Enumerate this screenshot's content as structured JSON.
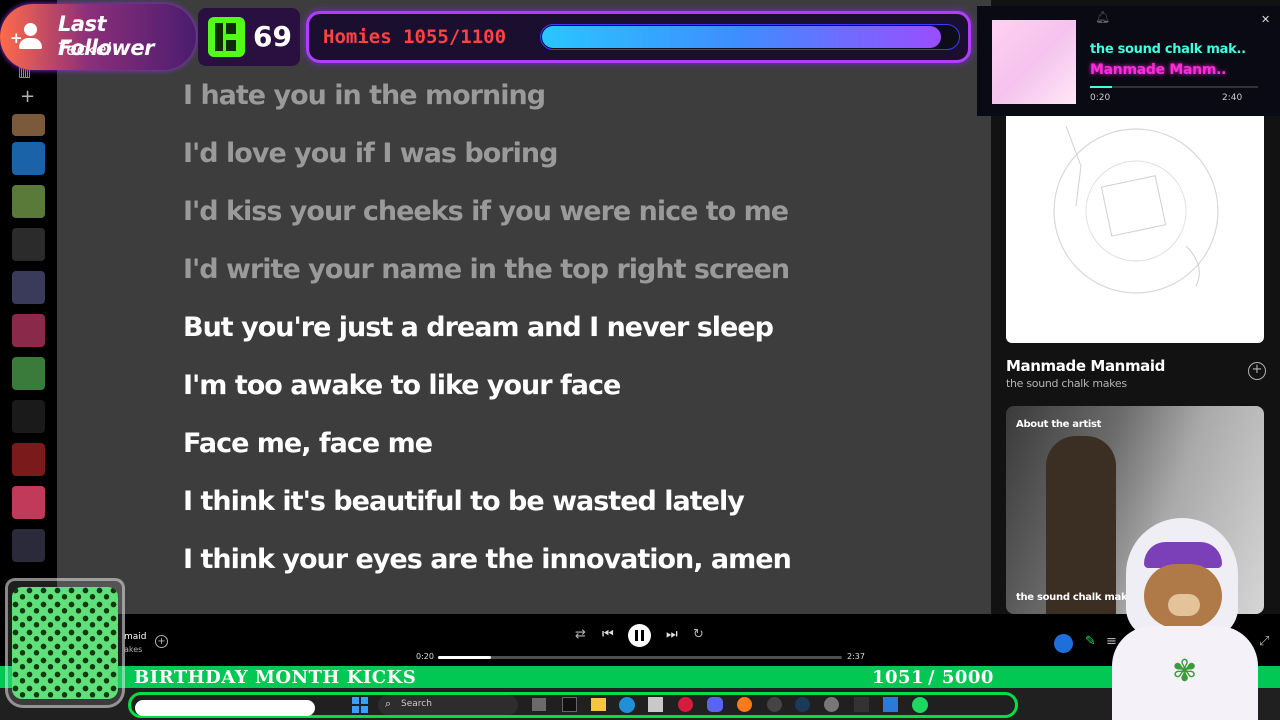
{
  "overlay": {
    "follower_title": "Last Follower",
    "follower_name": "Teckel",
    "kick_count": "69",
    "homies_label": "Homies 1055/1100",
    "homies_progress": 0.959
  },
  "now_playing_widget": {
    "title": "the sound chalk mak..",
    "artist": "Manmade Manm..",
    "elapsed": "0:20",
    "duration": "2:40"
  },
  "lyrics": [
    {
      "text": "I hate you in the morning",
      "state": "past"
    },
    {
      "text": "I'd love you if I was boring",
      "state": "past"
    },
    {
      "text": "I'd kiss your cheeks if you were nice to me",
      "state": "past"
    },
    {
      "text": "I'd write your name in the top right screen",
      "state": "past"
    },
    {
      "text": "But you're just a dream and I never sleep",
      "state": "current"
    },
    {
      "text": "I'm too awake to like your face",
      "state": "next"
    },
    {
      "text": "Face me, face me",
      "state": "next"
    },
    {
      "text": "I think it's beautiful to be wasted lately",
      "state": "next"
    },
    {
      "text": "I think your eyes are the innovation, amen",
      "state": "next"
    }
  ],
  "right_panel": {
    "track_title": "Manmade Manmaid",
    "track_artist": "the sound chalk makes",
    "about_label": "About the artist",
    "artist_name": "the sound chalk makes"
  },
  "player": {
    "track_title_partial": "maid",
    "track_artist_partial": "akes",
    "elapsed": "0:20",
    "duration": "2:37",
    "progress": 0.13
  },
  "kicks_bar": {
    "label": "BIRTHDAY MONTH KICKS",
    "count": "1051",
    "goal": "/ 5000"
  },
  "taskbar": {
    "search_placeholder": "Search"
  },
  "colors": {
    "lyrics_bg": "#3d3d3d",
    "homies_accent": "#b23cff",
    "kicks_green": "#00c853",
    "kick_brand": "#53fc18"
  }
}
